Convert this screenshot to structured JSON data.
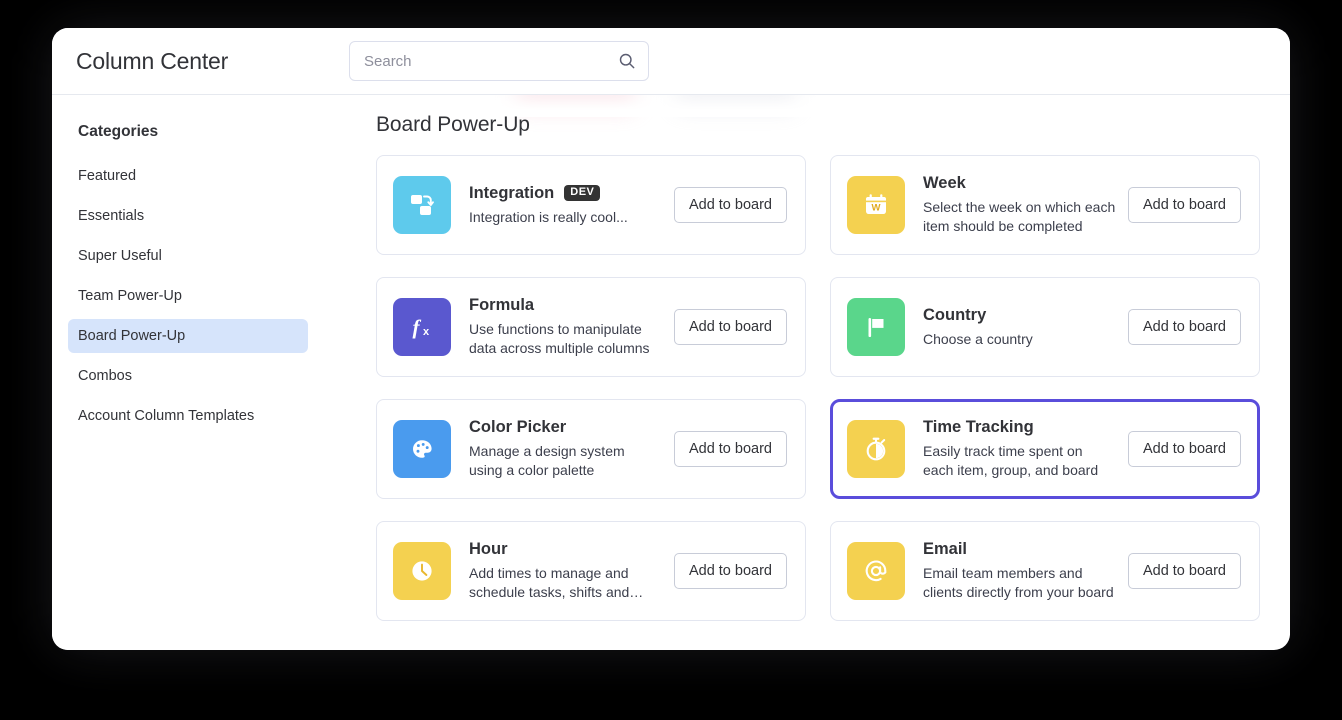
{
  "header": {
    "title": "Column Center",
    "search": {
      "placeholder": "Search",
      "value": "",
      "icon": "search-icon"
    }
  },
  "sidebar": {
    "heading": "Categories",
    "items": [
      {
        "label": "Featured",
        "active": false
      },
      {
        "label": "Essentials",
        "active": false
      },
      {
        "label": "Super Useful",
        "active": false
      },
      {
        "label": "Team Power-Up",
        "active": false
      },
      {
        "label": "Board Power-Up",
        "active": true
      },
      {
        "label": "Combos",
        "active": false
      },
      {
        "label": "Account Column Templates",
        "active": false
      }
    ],
    "active_color": "#d6e4fb"
  },
  "main": {
    "section_title": "Board Power-Up",
    "add_button_label": "Add to board",
    "selected_card": "Time Tracking",
    "selection_color": "#5a4ddb",
    "cards": [
      {
        "title": "Integration",
        "badge": "DEV",
        "description": "Integration is really cool...",
        "icon": "integration-icon",
        "icon_bg": "#5ecaec",
        "button": "Add to board",
        "selected": false
      },
      {
        "title": "Week",
        "badge": "",
        "description": "Select the week on which each item should be completed",
        "icon": "calendar-week-icon",
        "icon_bg": "#f4d150",
        "button": "Add to board",
        "selected": false
      },
      {
        "title": "Formula",
        "badge": "",
        "description": "Use functions to manipulate data across multiple columns",
        "icon": "formula-fx-icon",
        "icon_bg": "#5a58cf",
        "button": "Add to board",
        "selected": false
      },
      {
        "title": "Country",
        "badge": "",
        "description": "Choose a country",
        "icon": "flag-icon",
        "icon_bg": "#5ad68b",
        "button": "Add to board",
        "selected": false
      },
      {
        "title": "Color Picker",
        "badge": "",
        "description": "Manage a design system using a color palette",
        "icon": "palette-icon",
        "icon_bg": "#4a9bee",
        "button": "Add to board",
        "selected": false
      },
      {
        "title": "Time Tracking",
        "badge": "",
        "description": "Easily track time spent on each item, group, and board",
        "icon": "stopwatch-icon",
        "icon_bg": "#f4d150",
        "button": "Add to board",
        "selected": true
      },
      {
        "title": "Hour",
        "badge": "",
        "description": "Add times to manage and schedule tasks, shifts and…",
        "icon": "clock-icon",
        "icon_bg": "#f4d150",
        "button": "Add to board",
        "selected": false
      },
      {
        "title": "Email",
        "badge": "",
        "description": "Email team members and clients directly from your board",
        "icon": "at-sign-icon",
        "icon_bg": "#f4d150",
        "button": "Add to board",
        "selected": false
      }
    ]
  }
}
